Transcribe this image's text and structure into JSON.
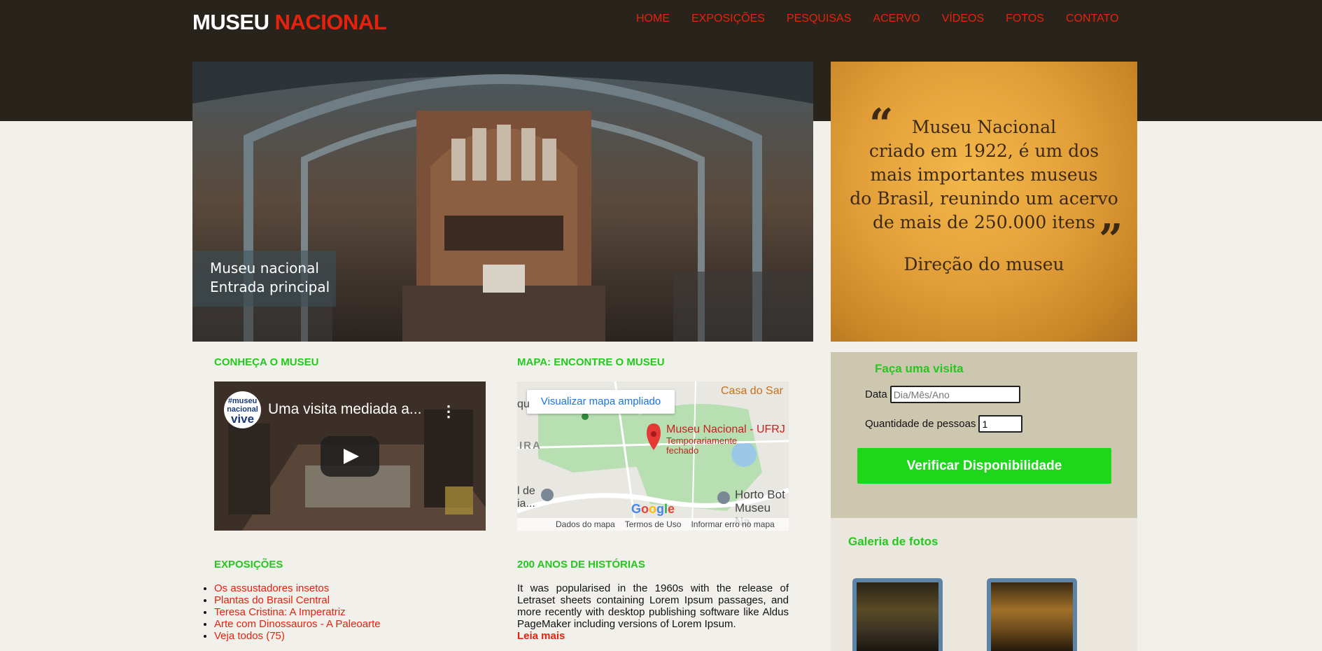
{
  "brand": {
    "part1": "MUSEU",
    "part2": "NACIONAL"
  },
  "nav": [
    "HOME",
    "EXPOSIÇÕES",
    "PESQUISAS",
    "ACERVO",
    "VÍDEOS",
    "FOTOS",
    "CONTATO"
  ],
  "hero": {
    "caption_line1": "Museu nacional",
    "caption_line2": "Entrada principal"
  },
  "quote": {
    "lines": [
      "Museu Nacional",
      "criado em 1922, é um dos",
      "mais importantes museus",
      "do Brasil, reunindo um acervo",
      "de mais de 250.000 itens"
    ],
    "open_mark": "“",
    "close_mark": "”",
    "signature": "Direção do museu"
  },
  "booking": {
    "title": "Faça uma visita",
    "date_label": "Data",
    "date_placeholder": "Dia/Mês/Ano",
    "qty_label": "Quantidade de pessoas",
    "qty_value": "1",
    "button": "Verificar Disponibilidade"
  },
  "gallery": {
    "title": "Galeria de fotos"
  },
  "sections": {
    "museum": "CONHEÇA O MUSEU",
    "map": "MAPA: ENCONTRE O MUSEU",
    "exhibitions": "EXPOSIÇÕES",
    "history": "200 ANOS DE HISTÓRIAS"
  },
  "video": {
    "title": "Uma visita mediada a...",
    "logo_top": "#museu",
    "logo_mid": "nacional",
    "logo_bottom": "vive",
    "menu_icon": "⋮"
  },
  "map": {
    "button": "Visualizar mapa ampliado",
    "place": "Museu Nacional - UFRJ",
    "place_status_1": "Temporariamente",
    "place_status_2": "fechado",
    "label_top_right": "Casa do Sar",
    "label_left_1": "IRA",
    "label_left_2": "l de",
    "label_left_3": "ia...",
    "label_right_1": "Horto Bot",
    "label_right_2": "Museu Na",
    "label_top_left": "qu",
    "google": "Google",
    "footer": [
      "Dados do mapa",
      "Termos de Uso",
      "Informar erro no mapa"
    ]
  },
  "exhibitions": [
    "Os assustadores insetos",
    "Plantas do Brasil Central",
    "Teresa Cristina: A Imperatriz",
    "Arte com Dinossauros - A Paleoarte",
    "Veja todos (75)"
  ],
  "history": {
    "text": "It was popularised in the 1960s with the release of Letraset sheets containing Lorem Ipsum passages, and more recently with desktop publishing software like Aldus PageMaker including versions of Lorem Ipsum.",
    "read_more": "Leia mais"
  }
}
